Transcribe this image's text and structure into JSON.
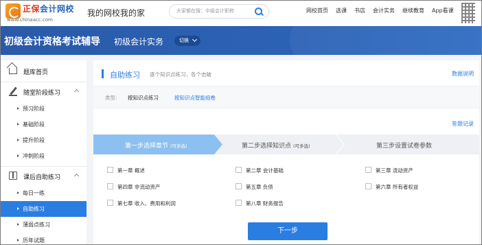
{
  "header": {
    "logo_brand_main": "正保",
    "logo_brand_rest": "会计网校",
    "logo_sub": "www.chinaacc.com",
    "site_title": "我的网校我的家",
    "search_placeholder": "大家都在搜：中级会计职称",
    "links": [
      "网校首页",
      "选课",
      "书店",
      "会计实务",
      "继续教育",
      "App看课"
    ]
  },
  "banner": {
    "title": "初级会计资格考试辅导",
    "subject": "初级会计实务",
    "switch_label": "切换"
  },
  "sidebar": {
    "home": "题库首页",
    "group1": {
      "title": "随堂阶段练习",
      "items": [
        "预习阶段",
        "基础阶段",
        "提升阶段",
        "冲刺阶段"
      ]
    },
    "group2": {
      "title": "课后自助练习",
      "items": [
        "每日一练",
        "自助练习",
        "薄弱点练习",
        "历年试题"
      ],
      "active_index": 1
    }
  },
  "main": {
    "title": "自助练习",
    "desc": "逐个知识点练习，各个击破",
    "help_link": "数据说明",
    "type_label": "类型:",
    "type_options": [
      "按知识点练习",
      "按知识点智能组卷"
    ],
    "records_link": "答题记录",
    "steps": [
      {
        "label": "第一步选择章节",
        "note": "(可多选)"
      },
      {
        "label": "第二步选择知识点",
        "note": "(可多选)"
      },
      {
        "label": "第三步设置试卷参数",
        "note": ""
      }
    ],
    "chapters": [
      "第一章 概述",
      "第二章 会计基础",
      "第三章 流动资产",
      "第四章 非流动资产",
      "第五章 负债",
      "第六章 所有者权益",
      "第七章 收入、费用和利润",
      "第八章 财务报告"
    ],
    "next_button": "下一步"
  },
  "colors": {
    "accent": "#2a7de1",
    "banner": "#2c62b5",
    "step_active": "#8cc0f0",
    "step_inactive": "#eef0f3"
  }
}
